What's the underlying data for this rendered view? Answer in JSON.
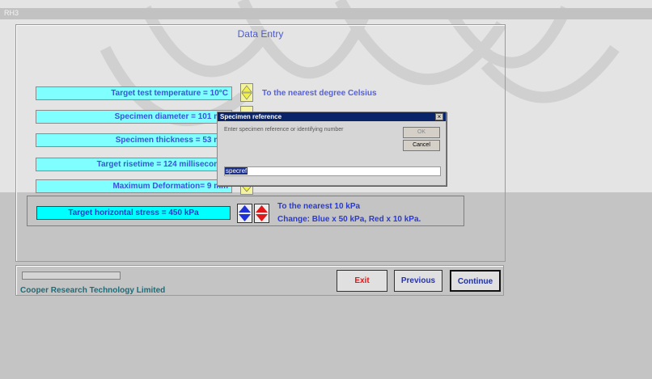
{
  "window": {
    "title": "RH3"
  },
  "panel": {
    "title": "Data Entry"
  },
  "fields": [
    {
      "label": "Target test temperature  =  10°C",
      "note": "To the nearest degree Celsius"
    },
    {
      "label": "Specimen diameter =  101 mm",
      "note": ""
    },
    {
      "label": "Specimen thickness =  53 mm",
      "note": ""
    },
    {
      "label": "Target risetime =  124 milliseconds",
      "note": ""
    },
    {
      "label": "Maximum Deformation=  9 mm",
      "note": ""
    }
  ],
  "stress": {
    "label": "Target horizontal stress =  450 kPa",
    "note_line1": "To the nearest 10 kPa",
    "note_line2": "Change: Blue x 50 kPa, Red x 10 kPa."
  },
  "footer": {
    "company": "Cooper Research Technology Limited",
    "exit_label": "Exit",
    "previous_label": "Previous",
    "continue_label": "Continue"
  },
  "dialog": {
    "title": "Specimen reference",
    "close_glyph": "×",
    "prompt": "Enter specimen reference or identifying number",
    "ok_label": "OK",
    "cancel_label": "Cancel",
    "input_value": "specref"
  },
  "colors": {
    "field_bg": "#7fffff",
    "field_text": "#3a55d8",
    "blue_spinner": "#2030d8",
    "red_spinner": "#e01818",
    "exit_text": "#e01818",
    "nav_text": "#2030c8"
  }
}
